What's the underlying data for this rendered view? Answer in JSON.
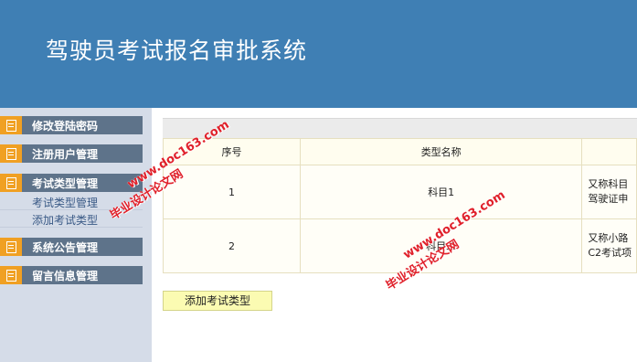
{
  "header": {
    "title": "驾驶员考试报名审批系统"
  },
  "sidebar": {
    "menus": [
      {
        "label": "修改登陆密码"
      },
      {
        "label": "注册用户管理"
      },
      {
        "label": "考试类型管理",
        "subs": [
          {
            "label": "考试类型管理"
          },
          {
            "label": "添加考试类型"
          }
        ]
      },
      {
        "label": "系统公告管理"
      },
      {
        "label": "留言信息管理"
      }
    ]
  },
  "table": {
    "headers": [
      "序号",
      "类型名称",
      ""
    ],
    "rows": [
      {
        "index": "1",
        "name": "科目1",
        "desc_line1": "又称科目",
        "desc_line2": "驾驶证申"
      },
      {
        "index": "2",
        "name": "科目二",
        "desc_line1": "又称小路",
        "desc_line2": "C2考试项"
      }
    ]
  },
  "actions": {
    "add_label": "添加考试类型"
  },
  "watermarks": [
    {
      "line1": "www.doc163.com",
      "line2": "毕业设计论文网"
    },
    {
      "line1": "www.doc163.com",
      "line2": "毕业设计论文网"
    }
  ],
  "colors": {
    "header_bg": "#3f7fb4",
    "menu_bg": "#5e738a",
    "menu_icon": "#f0a023",
    "watermark": "#e0202a"
  }
}
